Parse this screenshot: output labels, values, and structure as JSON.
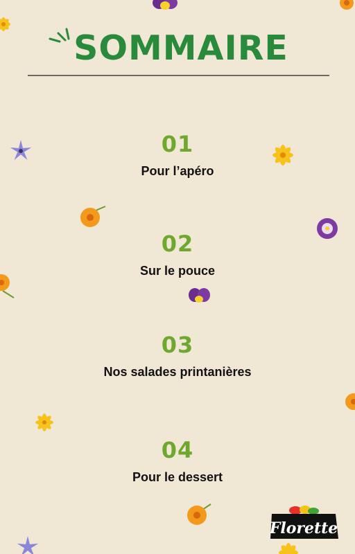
{
  "header": {
    "title": "SOMMAIRE"
  },
  "toc": [
    {
      "number": "01",
      "label": "Pour l’apéro"
    },
    {
      "number": "02",
      "label": "Sur le pouce"
    },
    {
      "number": "03",
      "label": "Nos salades printanières"
    },
    {
      "number": "04",
      "label": "Pour le dessert"
    }
  ],
  "brand": {
    "logo_text": "Florette"
  },
  "colors": {
    "background": "#f1e7d5",
    "title_green": "#2a8a3c",
    "number_green": "#6fa82e",
    "text": "#111111",
    "rule": "#6d6a62"
  },
  "decorations": [
    "yellow-flower-icon",
    "orange-marigold-icon",
    "purple-pansy-icon",
    "blue-borage-icon"
  ]
}
